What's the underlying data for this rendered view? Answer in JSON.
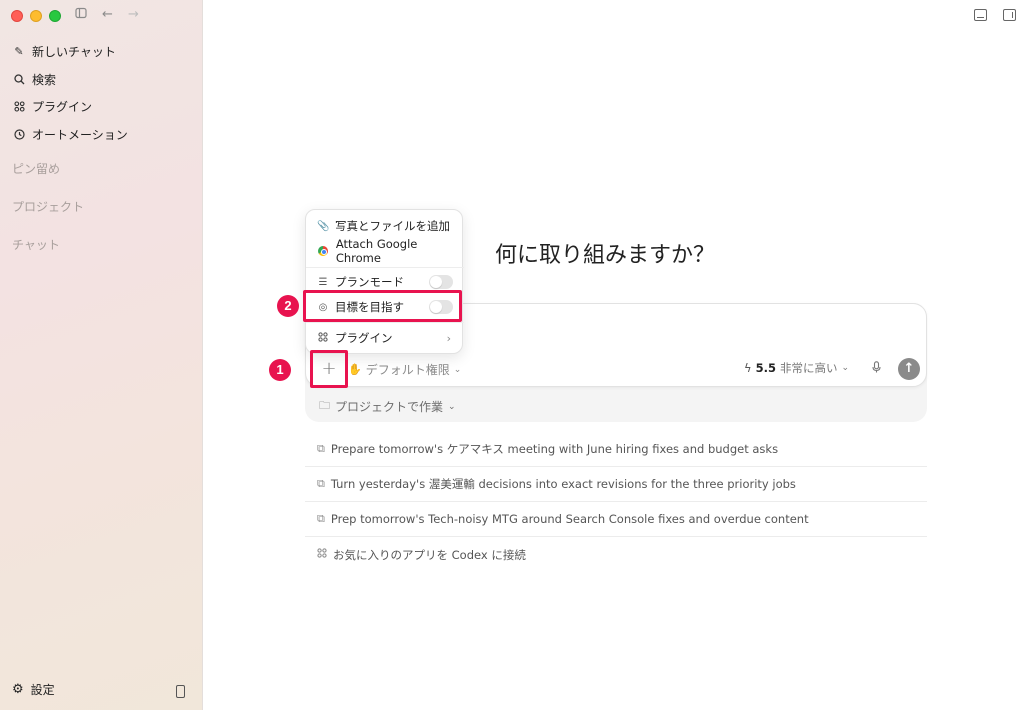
{
  "sidebar": {
    "items": [
      {
        "label": "新しいチャット",
        "icon": "edit-icon"
      },
      {
        "label": "検索",
        "icon": "search-icon"
      },
      {
        "label": "プラグイン",
        "icon": "plugin-grid-icon"
      },
      {
        "label": "オートメーション",
        "icon": "clock-icon"
      }
    ],
    "sections": {
      "pinned": "ピン留め",
      "projects": "プロジェクト",
      "chats": "チャット"
    },
    "settings_label": "設定"
  },
  "main": {
    "heading": "何に取り組みますか？",
    "composer": {
      "permission_label": "デフォルト権限",
      "model_version": "5.5",
      "model_level": "非常に高い"
    },
    "project_work_label": "プロジェクトで作業",
    "suggestions": [
      "Prepare tomorrow's ケアマキス meeting with June hiring fixes and budget asks",
      "Turn yesterday's 渥美運輸 decisions into exact revisions for the three priority jobs",
      "Prep tomorrow's Tech-noisy MTG around Search Console fixes and overdue content",
      "お気に入りのアプリを Codex に接続"
    ]
  },
  "menu": {
    "items": [
      {
        "label": "写真とファイルを追加",
        "icon": "paperclip-icon"
      },
      {
        "label": "Attach Google Chrome",
        "icon": "chrome-icon"
      },
      {
        "label": "プランモード",
        "icon": "checklist-icon",
        "toggle": false
      },
      {
        "label": "目標を目指す",
        "icon": "target-icon",
        "toggle": false
      },
      {
        "label": "プラグイン",
        "icon": "plugin-grid-icon"
      }
    ]
  },
  "annotations": {
    "badge1": "1",
    "badge2": "2",
    "color": "#e8134f"
  }
}
